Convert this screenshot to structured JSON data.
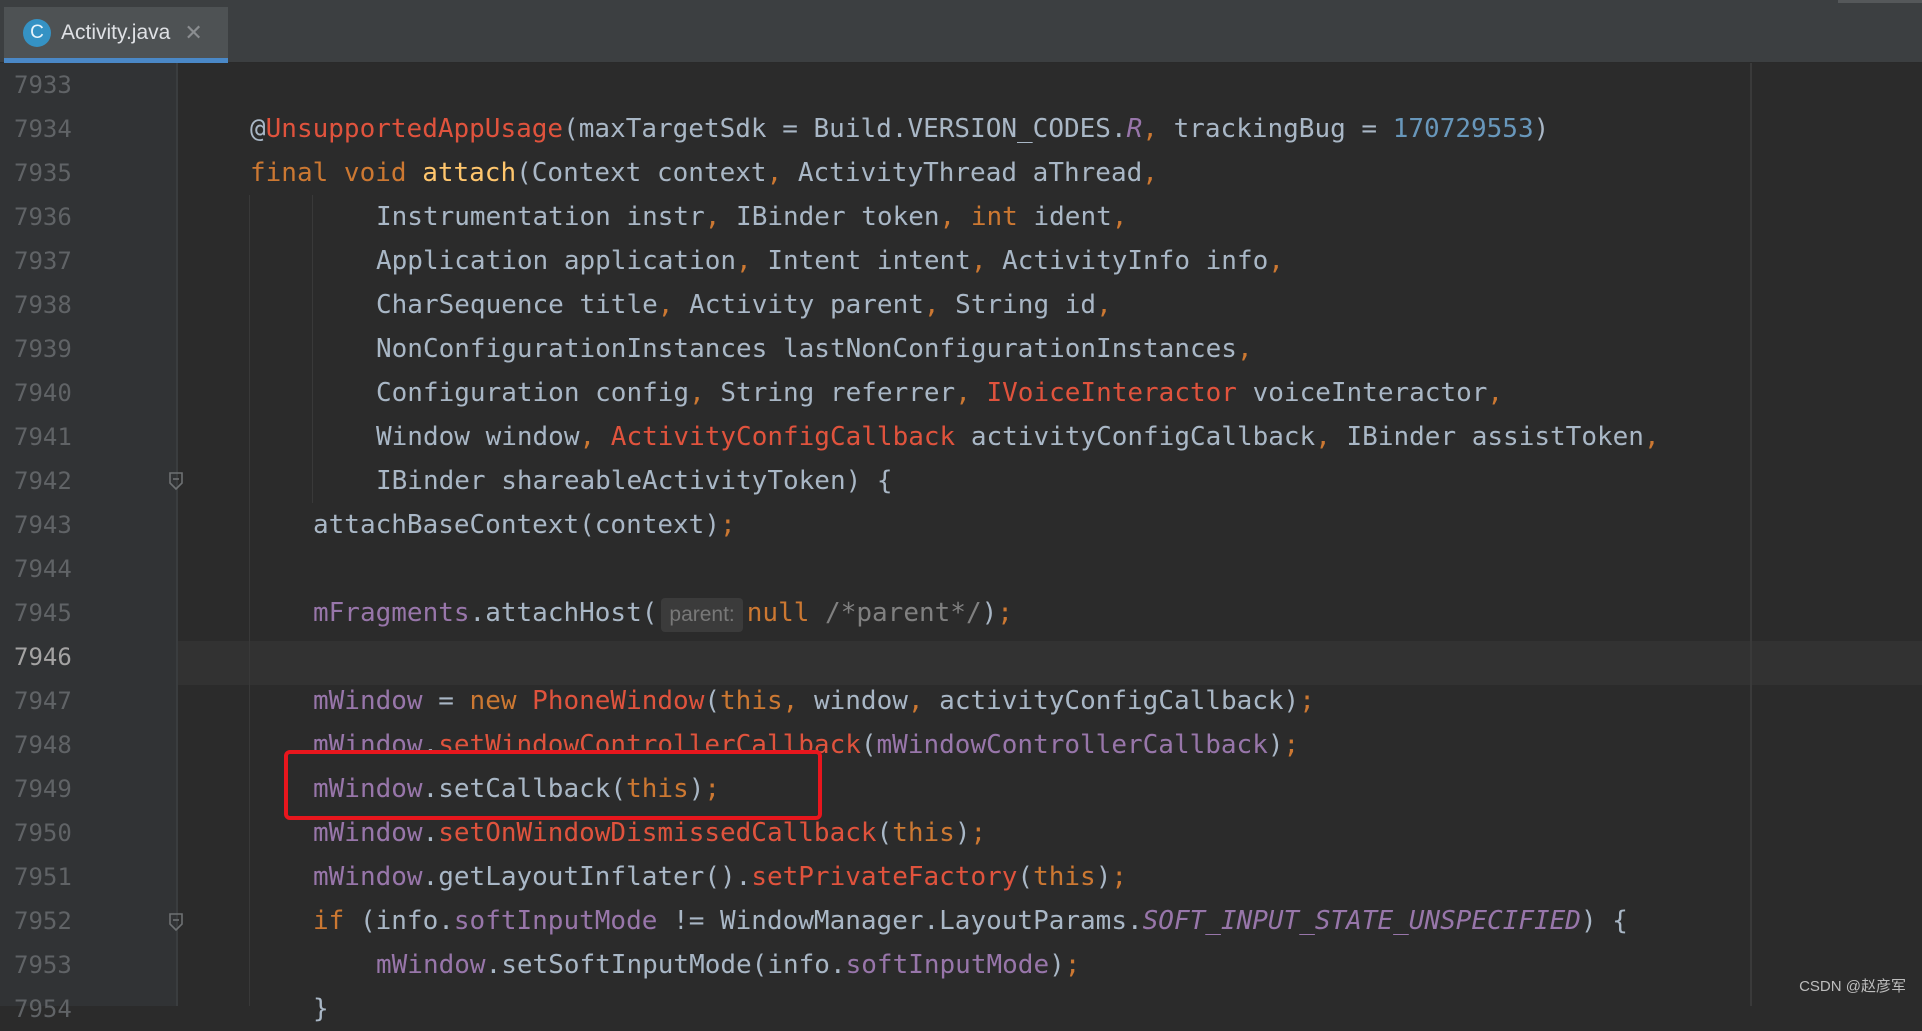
{
  "tab": {
    "icon_letter": "C",
    "label": "Activity.java",
    "close": "✕"
  },
  "colors": {
    "keyword": "#cc7832",
    "method_decl": "#ffc66d",
    "field": "#9876aa",
    "unresolved": "#e0533d",
    "number": "#6897bb",
    "text": "#a9b7c6",
    "highlight_box": "#e8161d"
  },
  "line_numbers": [
    "7933",
    "7934",
    "7935",
    "7936",
    "7937",
    "7938",
    "7939",
    "7940",
    "7941",
    "7942",
    "7943",
    "7944",
    "7945",
    "7946",
    "7947",
    "7948",
    "7949",
    "7950",
    "7951",
    "7952",
    "7953",
    "7954"
  ],
  "current_line": "7946",
  "code": {
    "l7934": {
      "at": "@",
      "anno": "UnsupportedAppUsage",
      "a1": "(maxTargetSdk = Build.VERSION_CODES.",
      "r": "R",
      "c1": ",",
      "a2": " trackingBug = ",
      "num": "170729553",
      "a3": ")"
    },
    "l7935": {
      "kw": "final void ",
      "fn": "attach",
      "a1": "(Context context",
      "c1": ",",
      "a2": " ActivityThread aThread",
      "c2": ","
    },
    "l7936": {
      "a1": "Instrumentation instr",
      "c1": ",",
      "a2": " IBinder token",
      "c2": ",",
      "kw": " int",
      "a3": " ident",
      "c3": ","
    },
    "l7937": {
      "a1": "Application application",
      "c1": ",",
      "a2": " Intent intent",
      "c2": ",",
      "a3": " ActivityInfo info",
      "c3": ","
    },
    "l7938": {
      "a1": "CharSequence title",
      "c1": ",",
      "a2": " Activity parent",
      "c2": ",",
      "a3": " String id",
      "c3": ","
    },
    "l7939": {
      "a1": "NonConfigurationInstances lastNonConfigurationInstances",
      "c1": ","
    },
    "l7940": {
      "a1": "Configuration config",
      "c1": ",",
      "a2": " String referrer",
      "c2": ",",
      "err": " IVoiceInteractor",
      "a3": " voiceInteractor",
      "c3": ","
    },
    "l7941": {
      "a1": "Window window",
      "c1": ",",
      "err": " ActivityConfigCallback",
      "a2": " activityConfigCallback",
      "c2": ",",
      "a3": " IBinder assistToken",
      "c3": ","
    },
    "l7942": {
      "a1": "IBinder shareableActivityToken) {"
    },
    "l7943": {
      "a1": "attachBaseContext(context)",
      "c1": ";"
    },
    "l7945": {
      "field": "mFragments",
      "a1": ".attachHost(",
      "hint": "parent:",
      "kw": "null",
      "cm": " /*parent*/",
      "a2": ")",
      "c1": ";"
    },
    "l7947": {
      "field": "mWindow",
      "a1": " = ",
      "kw": "new",
      "err": " PhoneWindow",
      "a2": "(",
      "kw2": "this",
      "c1": ",",
      "a3": " window",
      "c2": ",",
      "a4": " activityConfigCallback)",
      "c3": ";"
    },
    "l7948": {
      "field": "mWindow",
      "a1": ".",
      "err": "setWindowControllerCallback",
      "a2": "(",
      "field2": "mWindowControllerCallback",
      "a3": ")",
      "c1": ";"
    },
    "l7949": {
      "field": "mWindow",
      "a1": ".setCallback(",
      "kw": "this",
      "a2": ")",
      "c1": ";"
    },
    "l7950": {
      "field": "mWindow",
      "a1": ".",
      "err": "setOnWindowDismissedCallback",
      "a2": "(",
      "kw": "this",
      "a3": ")",
      "c1": ";"
    },
    "l7951": {
      "field": "mWindow",
      "a1": ".getLayoutInflater().",
      "err": "setPrivateFactory",
      "a2": "(",
      "kw": "this",
      "a3": ")",
      "c1": ";"
    },
    "l7952": {
      "kw": "if",
      "a1": " (info.",
      "field": "softInputMode",
      "a2": " != WindowManager.LayoutParams.",
      "st": "SOFT_INPUT_STATE_UNSPECIFIED",
      "a3": ") {"
    },
    "l7953": {
      "field": "mWindow",
      "a1": ".setSoftInputMode(info.",
      "field2": "softInputMode",
      "a2": ")",
      "c1": ";"
    },
    "l7954": {
      "a1": "}"
    }
  },
  "watermark": "CSDN @赵彦军"
}
